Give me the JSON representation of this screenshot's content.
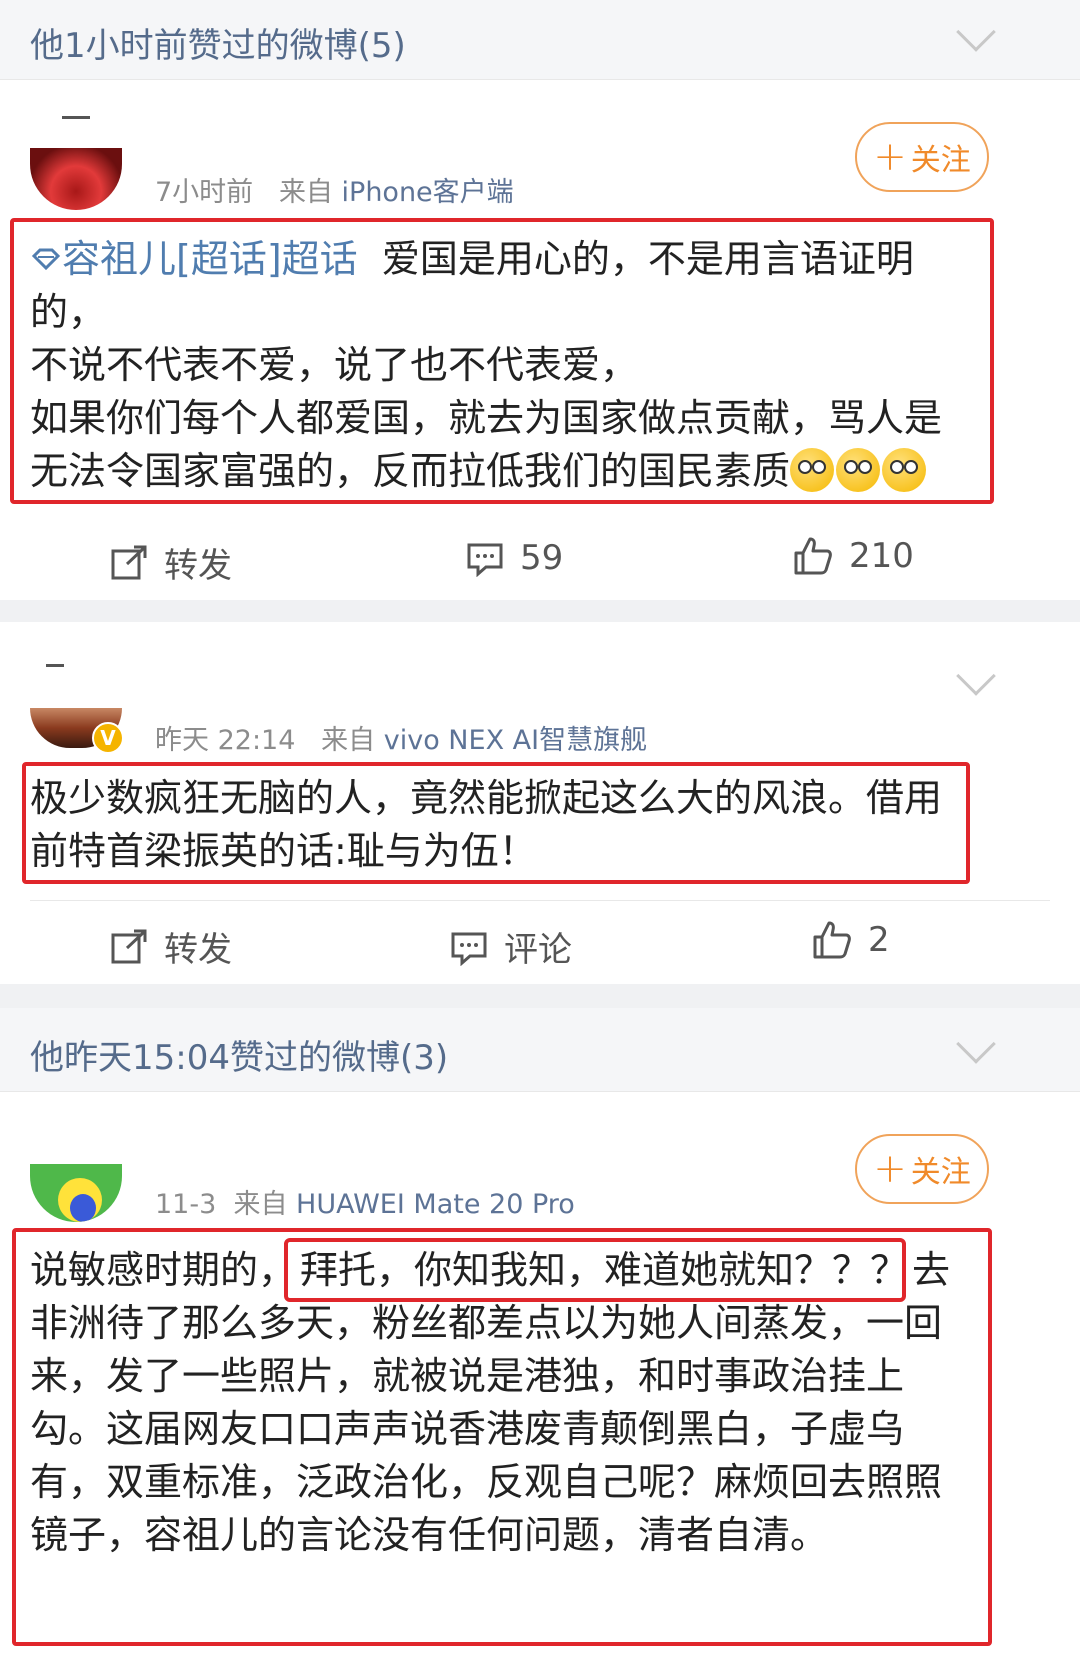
{
  "sections": [
    {
      "title": "他1小时前赞过的微博(5)"
    },
    {
      "title": "他昨天15:04赞过的微博(3)"
    }
  ],
  "posts": [
    {
      "meta_time": "7小时前",
      "meta_from": "来自",
      "meta_source": "iPhone客户端",
      "follow_label": "关注",
      "topic": "容祖儿[超话]超话",
      "text_line1": "爱国是用心的，不是用言语证明的，",
      "text_line2": "不说不代表不爱，说了也不代表爱，",
      "text_line3": "如果你们每个人都爱国，就去为国家做点贡献，骂人是无法令国家富强的，反而拉低我们的国民素质",
      "repost_label": "转发",
      "comment_count": "59",
      "like_count": "210"
    },
    {
      "meta_time": "昨天 22:14",
      "meta_from": "来自",
      "meta_source": "vivo NEX AI智慧旗舰",
      "verified_mark": "V",
      "text": "极少数疯狂无脑的人，竟然能掀起这么大的风浪。借用前特首梁振英的话:耻与为伍！",
      "repost_label": "转发",
      "comment_label": "评论",
      "like_count": "2"
    },
    {
      "meta_time": "11-3",
      "meta_from": "来自",
      "meta_source": "HUAWEI Mate 20 Pro",
      "follow_label": "关注",
      "text_pre": "说敏感时期的，",
      "text_highlight": "拜托，你知我知，难道她就知？？？",
      "text_post": "去非洲待了那么多天，粉丝都差点以为她人间蒸发，一回来，发了一些照片，就被说是港独，和时事政治挂上勾。这届网友口口声声说香港废青颠倒黑白，子虚乌有，双重标准，泛政治化，反观自己呢？麻烦回去照照镜子，容祖儿的言论没有任何问题，清者自清。"
    }
  ],
  "colors": {
    "accent_orange": "#f08a2a",
    "link_blue": "#507daf",
    "highlight_red": "#e0262b"
  }
}
